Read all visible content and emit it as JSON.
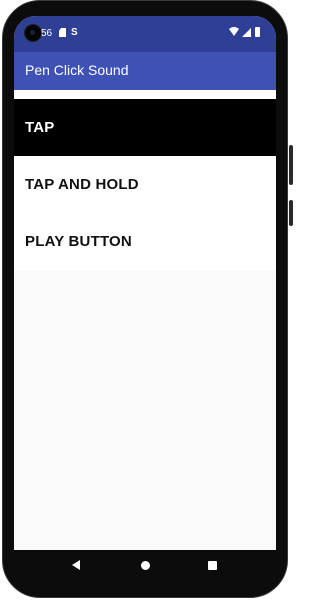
{
  "status_bar": {
    "time": "56",
    "icons": [
      "camera-icon",
      "sd-card-icon",
      "s-notification-icon",
      "wifi-icon",
      "signal-icon",
      "battery-icon"
    ]
  },
  "app_bar": {
    "title": "Pen Click Sound"
  },
  "menu": {
    "items": [
      {
        "label": "TAP",
        "selected": true
      },
      {
        "label": "TAP AND HOLD",
        "selected": false
      },
      {
        "label": "PLAY BUTTON",
        "selected": false
      }
    ]
  },
  "nav_bar": {
    "icons": [
      "back-icon",
      "home-icon",
      "recents-icon"
    ]
  },
  "colors": {
    "status_bar": "#2f3f95",
    "app_bar": "#3f51b5",
    "selected_item_bg": "#000000",
    "item_bg": "#ffffff",
    "screen_bg": "#fafafa"
  }
}
